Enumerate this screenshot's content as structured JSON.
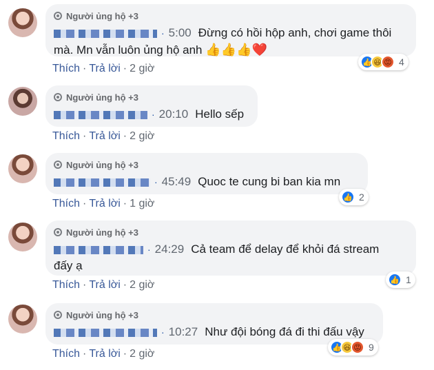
{
  "supporter_badge_label": "Người ủng hộ +3",
  "actions": {
    "like": "Thích",
    "reply": "Trả lời",
    "separator": "·"
  },
  "comments": [
    {
      "time": "5:00",
      "text_line1": "Đừng có hồi hộp anh, chơi game thôi",
      "text_line2": "mà. Mn vẫn luôn ủng hộ anh",
      "emojis": "👍👍👍❤️",
      "ago": "2 giờ",
      "reaction_count": "4",
      "reaction_icons": [
        "like-icon",
        "haha-icon",
        "angry-icon"
      ]
    },
    {
      "time": "20:10",
      "text_line1": "Hello sếp",
      "ago": "2 giờ"
    },
    {
      "time": "45:49",
      "text_line1": "Quoc te cung bi ban kia mn",
      "ago": "1 giờ",
      "reaction_count": "2",
      "reaction_icons": [
        "like-icon"
      ]
    },
    {
      "time": "24:29",
      "text_line1": "Cả team để delay để khỏi đá stream",
      "text_line2": "đấy ạ",
      "ago": "2 giờ",
      "reaction_count": "1",
      "reaction_icons": [
        "like-icon"
      ]
    },
    {
      "time": "10:27",
      "text_line1": "Như đội bóng đá đi thi đấu vậy",
      "ago": "2 giờ",
      "reaction_count": "9",
      "reaction_icons": [
        "like-icon",
        "haha-icon",
        "angry-icon"
      ]
    }
  ],
  "colors": {
    "link": "#385898",
    "bubble": "#f2f3f5",
    "like": "#1877f2"
  }
}
